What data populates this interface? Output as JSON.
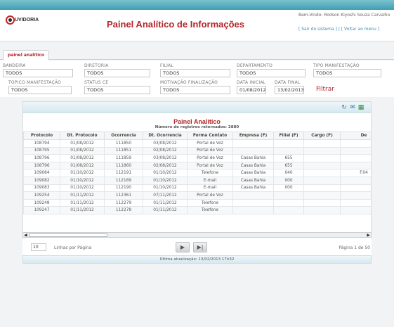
{
  "header": {
    "logo_text": "UVIDORIA",
    "title": "Painel Analítico de Informações",
    "welcome": "Bem-Vindo: Rodson Kiyoshi Souza Carvalho",
    "logout_link": "[ Sair do sistema ]",
    "back_link": "[ Voltar ao menu ]"
  },
  "tab": {
    "label": "painel analítico"
  },
  "filters": {
    "bandeira": {
      "label": "BANDEIRA",
      "value": "TODOS"
    },
    "diretoria": {
      "label": "DIRETORIA",
      "value": "TODOS"
    },
    "filial": {
      "label": "FILIAL",
      "value": "TODOS"
    },
    "departamento": {
      "label": "DEPARTAMENTO",
      "value": "TODOS"
    },
    "tipo_manifestacao": {
      "label": "TIPO MANIFESTAÇÃO",
      "value": "TODOS"
    },
    "topico_manifestacao": {
      "label": "TOPICO MANIFESTAÇÃO",
      "value": "TODOS"
    },
    "status_ce": {
      "label": "STATUS CE",
      "value": "TODOS"
    },
    "motivacao": {
      "label": "MOTIVAÇÃO FINALIZAÇÃO",
      "value": "TODOS"
    },
    "data_inicial": {
      "label": "DATA INICIAL",
      "value": "01/08/2012"
    },
    "data_final": {
      "label": "DATA FINAL",
      "value": "13/02/2013"
    },
    "filtrar_label": "Filtrar"
  },
  "panel": {
    "title": "Painel Analítico",
    "subtitle": "Número de registros retornados: 2880",
    "icons": [
      "refresh-icon",
      "email-icon",
      "excel-export-icon"
    ],
    "columns": [
      "Protocolo",
      "Dt. Protocolo",
      "Ocorrencia",
      "Dt. Ocorrencia",
      "Forma Contato",
      "Empresa (F)",
      "Filial (F)",
      "Cargo (F)",
      "De"
    ],
    "rows": [
      [
        "108794",
        "01/08/2012",
        "111850",
        "03/08/2012",
        "Portal de Voz",
        "",
        "",
        "",
        ""
      ],
      [
        "108795",
        "01/08/2012",
        "111851",
        "02/08/2012",
        "Portal de Voz",
        "",
        "",
        "",
        ""
      ],
      [
        "108796",
        "01/08/2012",
        "111859",
        "03/08/2012",
        "Portal de Voz",
        "Casas Bahia",
        "655",
        "",
        ""
      ],
      [
        "108796",
        "01/08/2012",
        "111860",
        "02/08/2012",
        "Portal de Voz",
        "Casas Bahia",
        "655",
        "",
        ""
      ],
      [
        "109084",
        "01/10/2012",
        "112191",
        "01/10/2012",
        "Telefone",
        "Casas Bahia",
        "040",
        "",
        "F.04"
      ],
      [
        "109082",
        "01/10/2012",
        "112189",
        "01/10/2012",
        "E-mail",
        "Casas Bahia",
        "000",
        "",
        ""
      ],
      [
        "109083",
        "01/10/2012",
        "112190",
        "01/10/2012",
        "E-mail",
        "Casas Bahia",
        "000",
        "",
        ""
      ],
      [
        "109254",
        "01/11/2012",
        "112361",
        "07/11/2012",
        "Portal de Voz",
        "",
        "",
        "",
        ""
      ],
      [
        "109248",
        "01/11/2012",
        "112279",
        "01/11/2012",
        "Telefone",
        "",
        "",
        "",
        ""
      ],
      [
        "109247",
        "01/11/2012",
        "112278",
        "01/11/2012",
        "Telefone",
        "",
        "",
        "",
        ""
      ]
    ]
  },
  "pager": {
    "per_page": "10",
    "per_page_label": "Linhas por Página",
    "next_label": "▶",
    "last_label": "▶|",
    "page_info": "Página 1 de 50"
  },
  "footer": {
    "last_update": "Última atualização: 13/02/2013 17h32"
  },
  "colors": {
    "brand": "#b3252b",
    "accent": "#3f9eb3",
    "link": "#3b8fb0"
  }
}
